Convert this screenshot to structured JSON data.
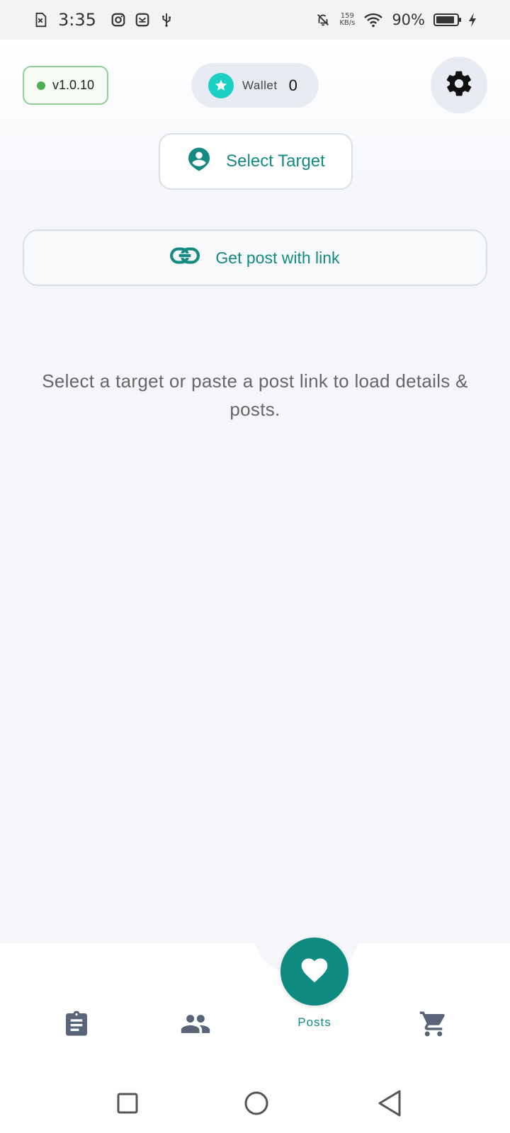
{
  "status_bar": {
    "time": "3:35",
    "net_speed_value": "159",
    "net_speed_unit": "KB/s",
    "battery_percent": "90%",
    "battery_level": 0.9
  },
  "header": {
    "version_label": "v1.0.10",
    "wallet_label": "Wallet",
    "wallet_value": "0"
  },
  "actions": {
    "select_target_label": "Select Target",
    "get_post_label": "Get post with link"
  },
  "empty_state": {
    "message": "Select a target or paste a post link to load details & posts."
  },
  "bottom_nav": {
    "items": [
      {
        "icon": "clipboard-icon"
      },
      {
        "icon": "people-icon"
      },
      {
        "icon": "heart-icon",
        "label": "Posts",
        "active": true
      },
      {
        "icon": "cart-icon"
      }
    ]
  },
  "colors": {
    "accent": "#148a80",
    "fab": "#0e8a80",
    "online_dot": "#4caf50",
    "wallet_star": "#1ccfc4"
  }
}
